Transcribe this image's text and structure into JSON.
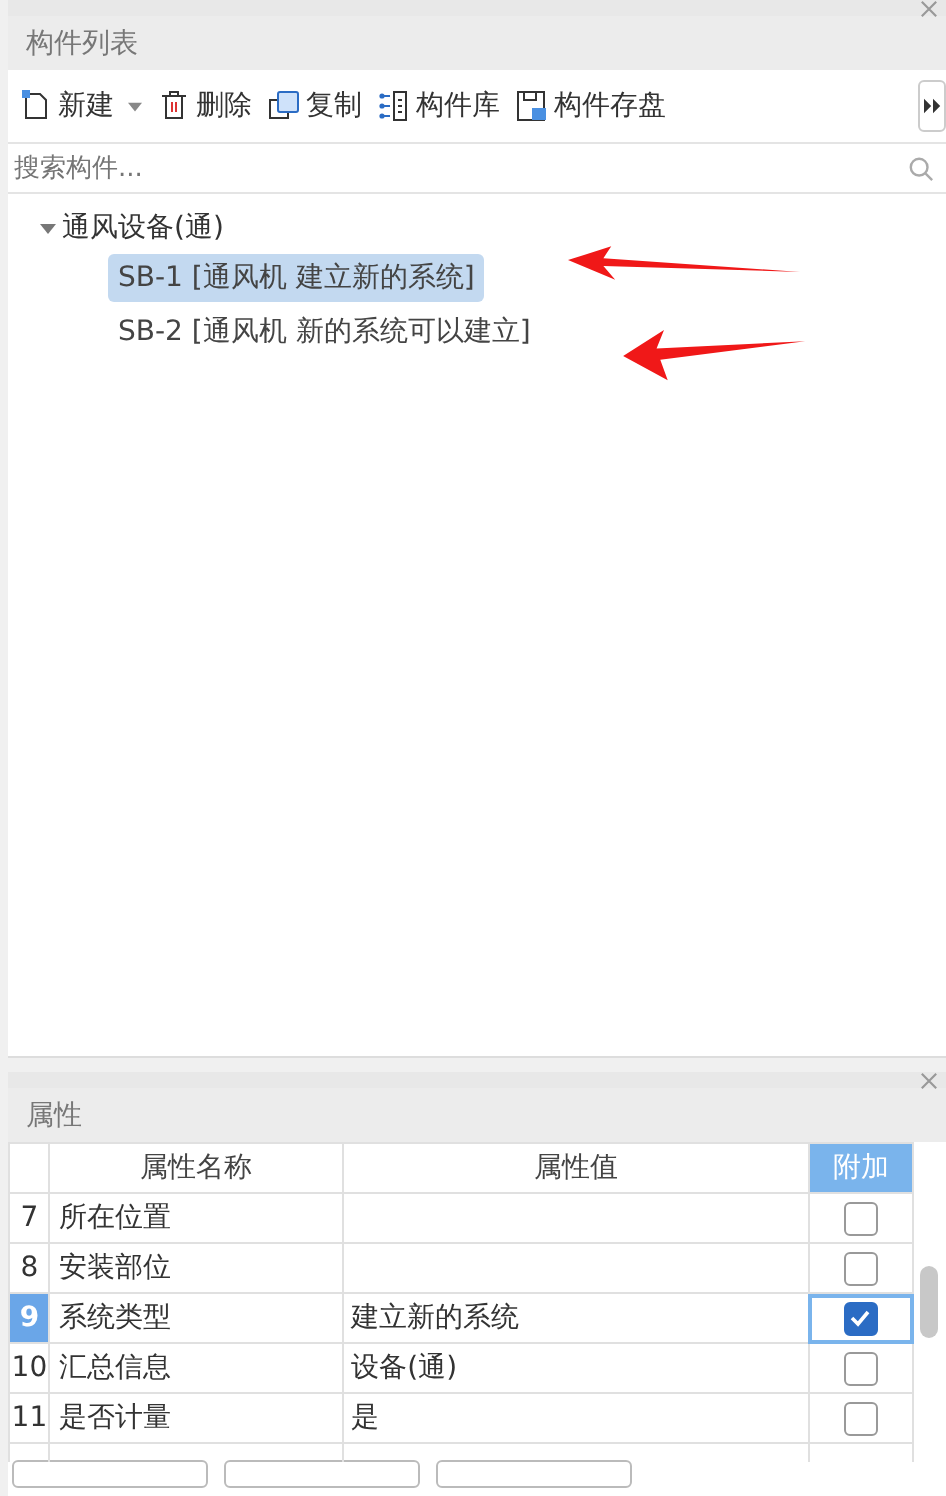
{
  "component_panel": {
    "title": "构件列表",
    "toolbar": [
      {
        "kind": "new",
        "label": "新建"
      },
      {
        "kind": "delete",
        "label": "删除"
      },
      {
        "kind": "copy",
        "label": "复制"
      },
      {
        "kind": "library",
        "label": "构件库"
      },
      {
        "kind": "save",
        "label": "构件存盘"
      }
    ],
    "search": {
      "placeholder": "搜索构件..."
    },
    "tree": [
      {
        "label": "通风设备(通)",
        "expanded": true,
        "children": [
          {
            "label": "SB-1 [通风机 建立新的系统]",
            "selected": true
          },
          {
            "label": "SB-2 [通风机 新的系统可以建立]",
            "selected": false
          }
        ]
      }
    ]
  },
  "properties_panel": {
    "title": "属性",
    "columns": [
      "属性名称",
      "属性值",
      "附加"
    ],
    "rows": [
      {
        "number": "7",
        "name": "所在位置",
        "value": "",
        "checked": false,
        "selected": false
      },
      {
        "number": "8",
        "name": "安装部位",
        "value": "",
        "checked": false,
        "selected": false
      },
      {
        "number": "9",
        "name": "系统类型",
        "value": "建立新的系统",
        "checked": true,
        "selected": true
      },
      {
        "number": "10",
        "name": "汇总信息",
        "value": "设备(通)",
        "checked": false,
        "selected": false
      },
      {
        "number": "11",
        "name": "是否计量",
        "value": "是",
        "checked": false,
        "selected": false
      }
    ]
  }
}
